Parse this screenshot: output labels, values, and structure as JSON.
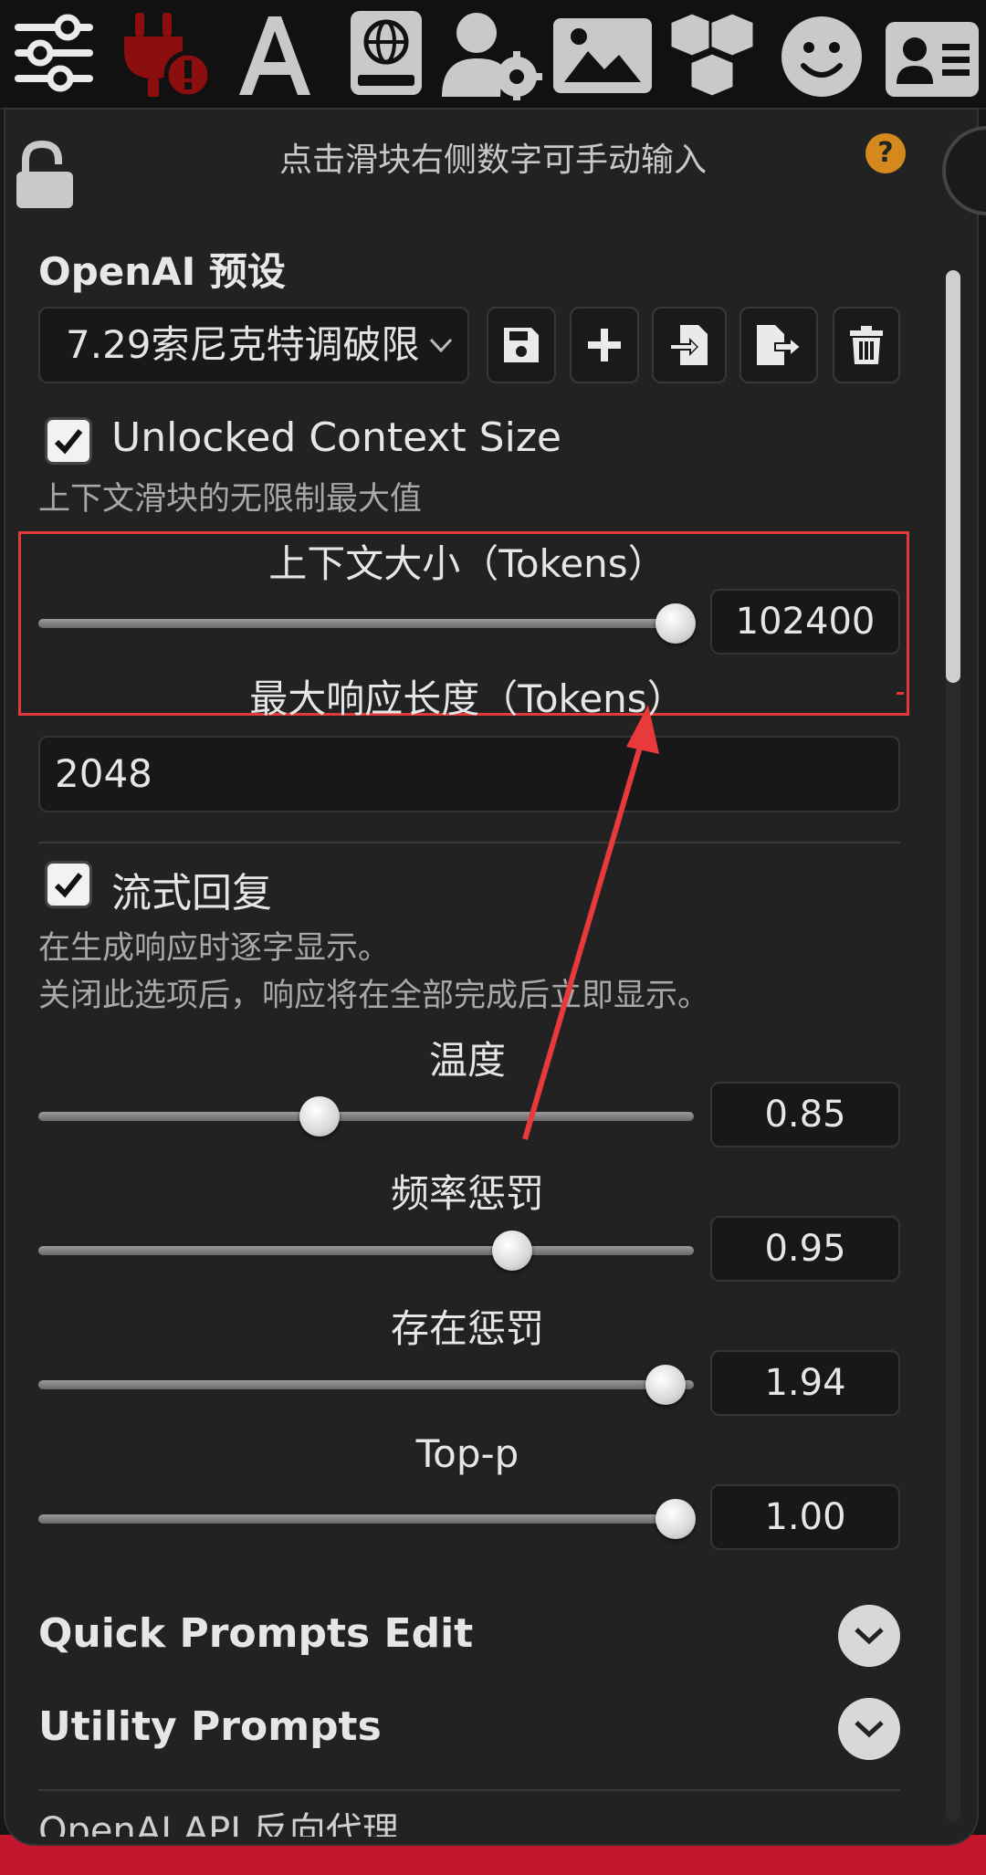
{
  "toolbar": {
    "icons": [
      "sliders-icon",
      "plug-warning-icon",
      "font-icon",
      "world-book-icon",
      "user-settings-icon",
      "image-icon",
      "extensions-cubes-icon",
      "smiley-icon",
      "persona-card-icon"
    ],
    "warning_color": "#8b0e0e"
  },
  "panel": {
    "hint": "点击滑块右侧数字可手动输入",
    "help_glyph": "?",
    "preset_title": "OpenAI 预设",
    "preset_selected": "7.29索尼克特调破限",
    "unlocked_context_label": "Unlocked Context Size",
    "unlocked_context_desc": "上下文滑块的无限制最大值",
    "context_size_title": "上下文大小（Tokens）",
    "context_size_value": "102400",
    "context_size_fraction": 0.97,
    "max_response_title": "最大响应长度（Tokens）",
    "max_response_value": "2048",
    "streaming_label": "流式回复",
    "streaming_desc_1": "在生成响应时逐字显示。",
    "streaming_desc_2": "关闭此选项后，响应将在全部完成后立即显示。",
    "sliders": [
      {
        "title": "温度",
        "value": "0.85",
        "fraction": 0.43
      },
      {
        "title": "频率惩罚",
        "value": "0.95",
        "fraction": 0.72
      },
      {
        "title": "存在惩罚",
        "value": "1.94",
        "fraction": 0.95
      },
      {
        "title": "Top-p",
        "value": "1.00",
        "fraction": 0.97
      }
    ],
    "quick_prompts_title": "Quick Prompts Edit",
    "utility_prompts_title": "Utility Prompts",
    "proxy_title": "OpenAI API 反向代理"
  },
  "colors": {
    "highlight_box": "#e23a3a",
    "arrow": "#e83a3a",
    "help_badge": "#d4891d"
  }
}
